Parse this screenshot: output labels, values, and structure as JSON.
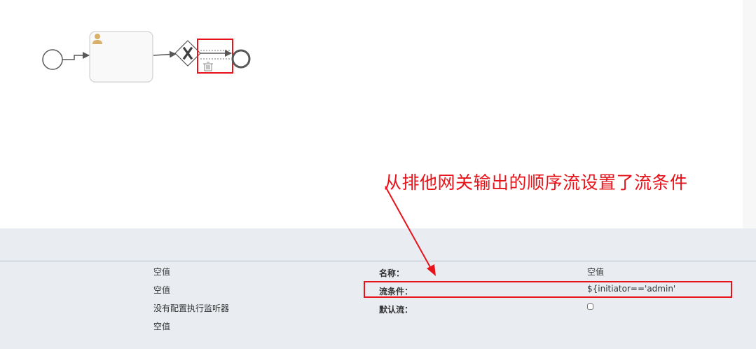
{
  "annotation": {
    "text": "从排他网关输出的顺序流设置了流条件"
  },
  "canvas": {
    "icons": {
      "user_task": "user-icon",
      "gateway": "exclusive-gateway-x",
      "delete": "trash-icon"
    },
    "highlight_color": "#e8131a"
  },
  "left_panel": {
    "values": [
      "空值",
      "空值",
      "没有配置执行监听器",
      "空值"
    ]
  },
  "properties": {
    "name": {
      "label": "名称：",
      "value": "空值"
    },
    "condition": {
      "label": "流条件：",
      "value": "${initiator=='admin'"
    },
    "default_flow": {
      "label": "默认流：",
      "checked": false
    }
  }
}
